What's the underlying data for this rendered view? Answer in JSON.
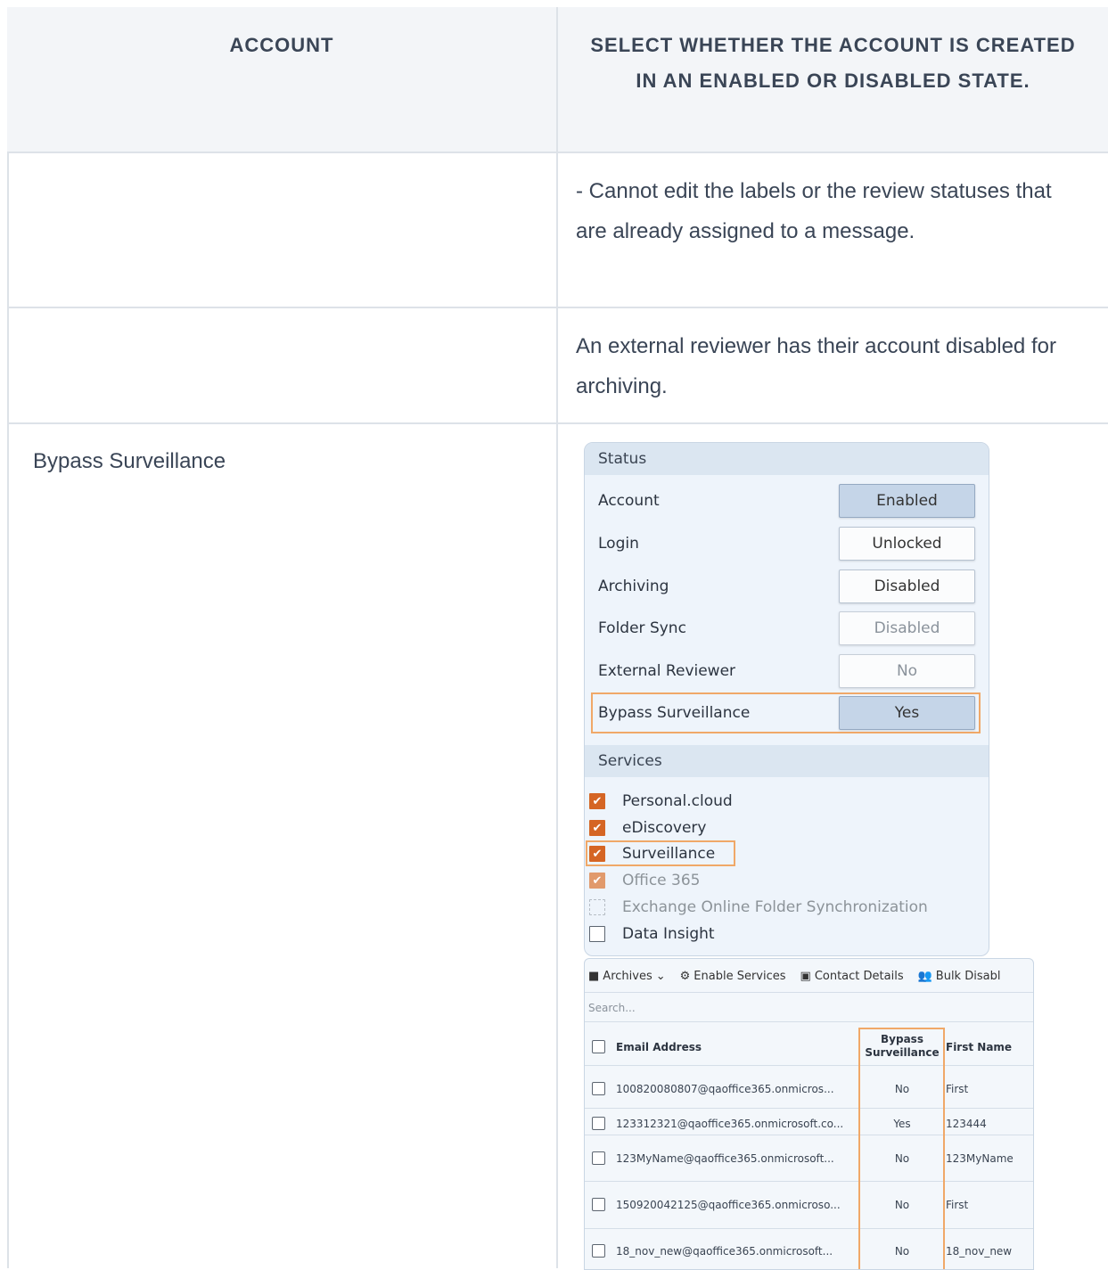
{
  "header": {
    "col1": "ACCOUNT",
    "col2": "SELECT WHETHER THE ACCOUNT IS CREATED IN AN ENABLED OR DISABLED STATE."
  },
  "rows": [
    {
      "left": "",
      "right": "- Cannot edit the labels or the review statuses that are already assigned to a message."
    },
    {
      "left": "",
      "right": "An external reviewer has their account disabled for archiving."
    },
    {
      "left": "Bypass Surveillance",
      "right": ""
    }
  ],
  "status_panel": {
    "status_heading": "Status",
    "items": [
      {
        "label": "Account",
        "value": "Enabled",
        "state": "active"
      },
      {
        "label": "Login",
        "value": "Unlocked",
        "state": "normal"
      },
      {
        "label": "Archiving",
        "value": "Disabled",
        "state": "normal"
      },
      {
        "label": "Folder Sync",
        "value": "Disabled",
        "state": "muted"
      },
      {
        "label": "External Reviewer",
        "value": "No",
        "state": "muted"
      },
      {
        "label": "Bypass Surveillance",
        "value": "Yes",
        "state": "active"
      }
    ],
    "services_heading": "Services",
    "services": [
      {
        "label": "Personal.cloud",
        "checked": true
      },
      {
        "label": "eDiscovery",
        "checked": true
      },
      {
        "label": "Surveillance",
        "checked": true
      },
      {
        "label": "Office 365",
        "checked": true
      },
      {
        "label": "Exchange Online Folder Synchronization",
        "checked": false
      },
      {
        "label": "Data Insight",
        "checked": false
      }
    ]
  },
  "accounts_table": {
    "toolbar": {
      "archives": "Archives",
      "enable_services": "Enable Services",
      "contact_details": "Contact Details",
      "bulk_disable": "Bulk Disabl"
    },
    "search_placeholder": "Search...",
    "columns": [
      "Email Address",
      "Bypass Surveillance",
      "First Name"
    ],
    "rows": [
      {
        "email": "100820080807@qaoffice365.onmicros...",
        "bypass": "No",
        "first": "First"
      },
      {
        "email": "123312321@qaoffice365.onmicrosoft.co...",
        "bypass": "Yes",
        "first": "123444"
      },
      {
        "email": "123MyName@qaoffice365.onmicrosoft...",
        "bypass": "No",
        "first": "123MyName"
      },
      {
        "email": "150920042125@qaoffice365.onmicroso...",
        "bypass": "No",
        "first": "First"
      },
      {
        "email": "18_nov_new@qaoffice365.onmicrosoft...",
        "bypass": "No",
        "first": "18_nov_new"
      }
    ]
  },
  "colors": {
    "highlight": "#f0a868",
    "checkbox": "#d56524",
    "border": "#dde2e8"
  }
}
